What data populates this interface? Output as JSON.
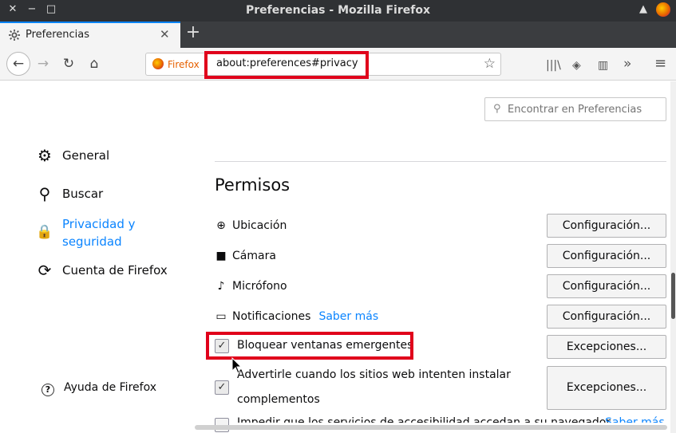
{
  "window": {
    "title": "Preferencias - Mozilla Firefox",
    "close_glyph": "✕",
    "minimize_glyph": "−",
    "maximize_glyph": "□",
    "up_glyph": "▲"
  },
  "tab": {
    "label": "Preferencias",
    "close_glyph": "✕",
    "new_tab_glyph": "+"
  },
  "navbar": {
    "back_glyph": "←",
    "forward_glyph": "→",
    "reload_glyph": "↻",
    "home_glyph": "⌂",
    "identity_label": "Firefox",
    "url": "about:preferences#privacy",
    "star_glyph": "☆",
    "library_glyph": "|||\\",
    "shield_glyph": "◈",
    "sidebar_glyph": "▥",
    "overflow_glyph": "»",
    "menu_glyph": "≡"
  },
  "search": {
    "placeholder": "Encontrar en Preferencias",
    "icon_glyph": "⚲"
  },
  "categories": {
    "general": {
      "label": "General",
      "icon": "⚙"
    },
    "search": {
      "label": "Buscar",
      "icon": "⚲"
    },
    "privacy": {
      "label_line1": "Privacidad y",
      "label_line2": "seguridad",
      "icon": "🔒"
    },
    "sync": {
      "label": "Cuenta de Firefox",
      "icon": "⟳"
    }
  },
  "help": {
    "label": "Ayuda de Firefox",
    "icon": "?"
  },
  "permissions": {
    "title": "Permisos",
    "location": {
      "label": "Ubicación",
      "icon": "⊕",
      "button": "Configuración..."
    },
    "camera": {
      "label": "Cámara",
      "icon": "■",
      "button": "Configuración..."
    },
    "microphone": {
      "label": "Micrófono",
      "icon": "♪",
      "button": "Configuración..."
    },
    "notifications": {
      "label": "Notificaciones",
      "icon": "▭",
      "learn_more": "Saber más",
      "button": "Configuración..."
    },
    "block_popups": {
      "label": "Bloquear ventanas emergentes",
      "checked": true,
      "check_glyph": "✓",
      "button": "Excepciones..."
    },
    "warn_addons": {
      "label_line1": "Advertirle cuando los sitios web intenten instalar",
      "label_line2": "complementos",
      "checked": true,
      "check_glyph": "✓",
      "button": "Excepciones..."
    },
    "accessibility": {
      "label": "Impedir que los servicios de accesibilidad accedan a su navegador",
      "learn_more": "Saber más"
    }
  }
}
